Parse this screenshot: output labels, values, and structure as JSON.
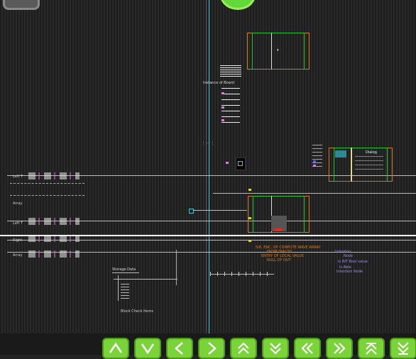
{
  "colors": {
    "background": "#222222",
    "accent_green": "#22c22a",
    "accent_orange": "#d97a1a",
    "cyan_line": "#3ec9d6",
    "label_orange": "#e07a1a",
    "label_purple": "#9a8cf0",
    "pink": "#e07ae0"
  },
  "top": {
    "left_button_icon": "gray-rounded-button",
    "right_button_icon": "green-round-button"
  },
  "canvas": {
    "label_center": "Instance of Board",
    "label_dialog_title": "Dialog",
    "label_bottom_group": "Storage Data",
    "label_bottom_note": "Block Check Items",
    "orange_note_line1": "5/8, ENC, OF COMPUTE WAVE ARRAY",
    "orange_note_line2": "FROM DIALOG",
    "orange_note_line3": "ENTRY OF LOCAL VALUE",
    "orange_note_line4": "NULL OF OUT",
    "purple_note_line1": "Intention",
    "purple_note_line2": "Node",
    "purple_note_line3": "Is INT  Bool value",
    "purple_note_line4": "Is Able",
    "purple_note_line5": "Intention Node",
    "left_labels": [
      "Left T",
      "Array",
      "Left T",
      "Right",
      "Array"
    ]
  },
  "toolbar": {
    "buttons": [
      {
        "name": "move-up-button",
        "icon": "up-arrow-icon"
      },
      {
        "name": "move-down-button",
        "icon": "down-arrow-icon"
      },
      {
        "name": "move-left-button",
        "icon": "left-arrow-icon"
      },
      {
        "name": "move-right-button",
        "icon": "right-arrow-icon"
      },
      {
        "name": "page-up-button",
        "icon": "double-up-arrow-icon"
      },
      {
        "name": "page-down-button",
        "icon": "double-down-arrow-icon"
      },
      {
        "name": "page-left-button",
        "icon": "double-left-arrow-icon"
      },
      {
        "name": "page-right-button",
        "icon": "double-right-arrow-icon"
      },
      {
        "name": "jump-top-button",
        "icon": "jump-top-icon"
      },
      {
        "name": "jump-bottom-button",
        "icon": "jump-bottom-icon"
      }
    ]
  }
}
